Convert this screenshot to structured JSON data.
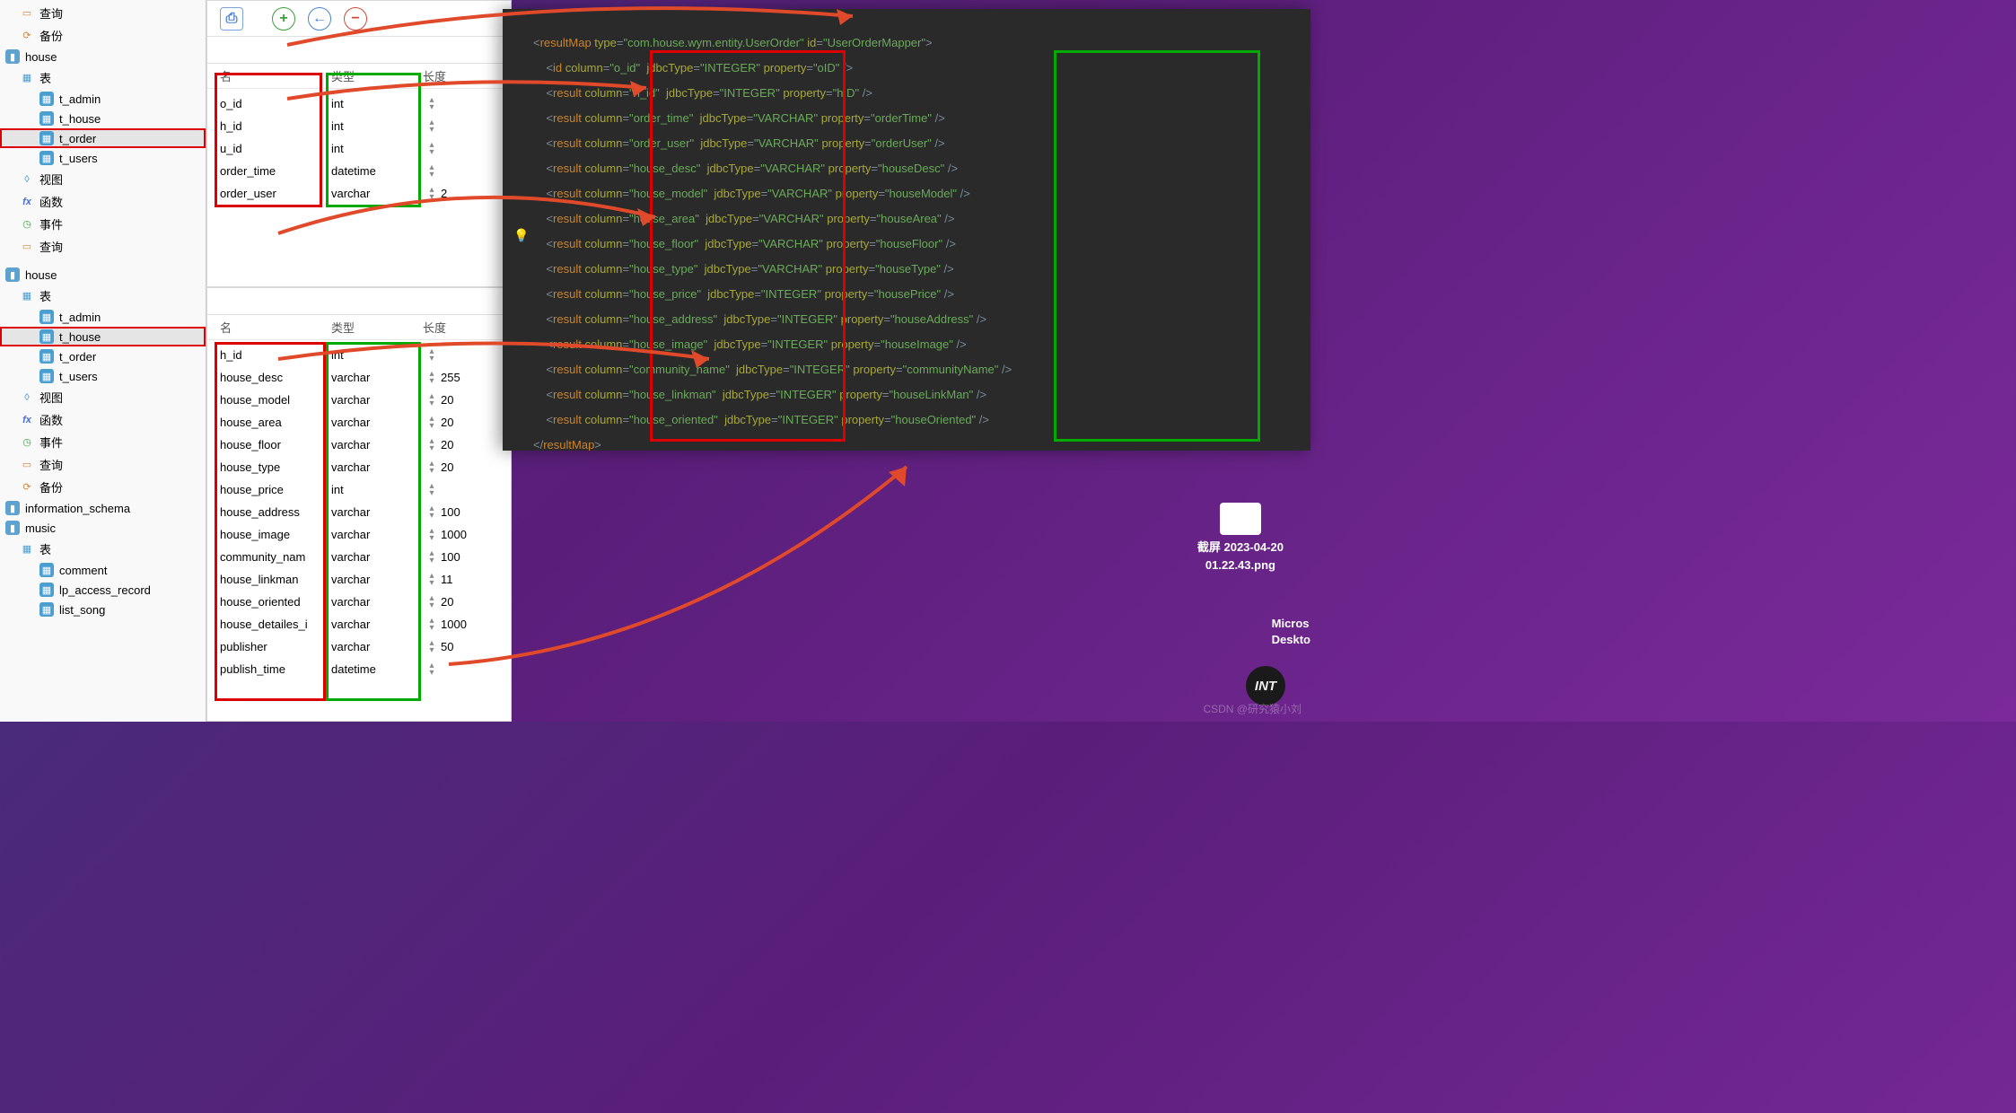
{
  "tree1": {
    "query": "查询",
    "backup": "备份",
    "db": "house",
    "tables": "表",
    "items": [
      "t_admin",
      "t_house",
      "t_order",
      "t_users"
    ],
    "selected": "t_order",
    "views": "视图",
    "fx": "函数",
    "events": "事件",
    "query2": "查询"
  },
  "tree2": {
    "db": "house",
    "tables": "表",
    "items": [
      "t_admin",
      "t_house",
      "t_order",
      "t_users"
    ],
    "selected": "t_house",
    "views": "视图",
    "fx": "函数",
    "events": "事件",
    "query": "查询",
    "backup": "备份",
    "infoschema": "information_schema",
    "music": "music",
    "music_tables": "表",
    "music_items": [
      "comment",
      "lp_access_record",
      "list_song"
    ]
  },
  "cols_header": {
    "name": "名",
    "type": "类型",
    "len": "长度"
  },
  "table1": {
    "rows": [
      {
        "n": "o_id",
        "t": "int",
        "l": ""
      },
      {
        "n": "h_id",
        "t": "int",
        "l": ""
      },
      {
        "n": "u_id",
        "t": "int",
        "l": ""
      },
      {
        "n": "order_time",
        "t": "datetime",
        "l": ""
      },
      {
        "n": "order_user",
        "t": "varchar",
        "l": "2"
      }
    ]
  },
  "table2": {
    "rows": [
      {
        "n": "h_id",
        "t": "int",
        "l": ""
      },
      {
        "n": "house_desc",
        "t": "varchar",
        "l": "255"
      },
      {
        "n": "house_model",
        "t": "varchar",
        "l": "20"
      },
      {
        "n": "house_area",
        "t": "varchar",
        "l": "20"
      },
      {
        "n": "house_floor",
        "t": "varchar",
        "l": "20"
      },
      {
        "n": "house_type",
        "t": "varchar",
        "l": "20"
      },
      {
        "n": "house_price",
        "t": "int",
        "l": ""
      },
      {
        "n": "house_address",
        "t": "varchar",
        "l": "100"
      },
      {
        "n": "house_image",
        "t": "varchar",
        "l": "1000"
      },
      {
        "n": "community_nam",
        "t": "varchar",
        "l": "100"
      },
      {
        "n": "house_linkman",
        "t": "varchar",
        "l": "11"
      },
      {
        "n": "house_oriented",
        "t": "varchar",
        "l": "20"
      },
      {
        "n": "house_detailes_i",
        "t": "varchar",
        "l": "1000"
      },
      {
        "n": "publisher",
        "t": "varchar",
        "l": "50"
      },
      {
        "n": "publish_time",
        "t": "datetime",
        "l": ""
      }
    ]
  },
  "code": {
    "type": "com.house.wym.entity.UserOrder",
    "id": "UserOrderMapper",
    "rows": [
      {
        "tag": "id",
        "col": "o_id",
        "jt": "INTEGER",
        "prop": "oID"
      },
      {
        "tag": "result",
        "col": "h_id",
        "jt": "INTEGER",
        "prop": "hID"
      },
      {
        "tag": "result",
        "col": "order_time",
        "jt": "VARCHAR",
        "prop": "orderTime"
      },
      {
        "tag": "result",
        "col": "order_user",
        "jt": "VARCHAR",
        "prop": "orderUser"
      },
      {
        "tag": "result",
        "col": "house_desc",
        "jt": "VARCHAR",
        "prop": "houseDesc"
      },
      {
        "tag": "result",
        "col": "house_model",
        "jt": "VARCHAR",
        "prop": "houseModel"
      },
      {
        "tag": "result",
        "col": "house_area",
        "jt": "VARCHAR",
        "prop": "houseArea"
      },
      {
        "tag": "result",
        "col": "house_floor",
        "jt": "VARCHAR",
        "prop": "houseFloor"
      },
      {
        "tag": "result",
        "col": "house_type",
        "jt": "VARCHAR",
        "prop": "houseType"
      },
      {
        "tag": "result",
        "col": "house_price",
        "jt": "INTEGER",
        "prop": "housePrice"
      },
      {
        "tag": "result",
        "col": "house_address",
        "jt": "INTEGER",
        "prop": "houseAddress"
      },
      {
        "tag": "result",
        "col": "house_image",
        "jt": "INTEGER",
        "prop": "houseImage"
      },
      {
        "tag": "result",
        "col": "community_name",
        "jt": "INTEGER",
        "prop": "communityName"
      },
      {
        "tag": "result",
        "col": "house_linkman",
        "jt": "INTEGER",
        "prop": "houseLinkMan"
      },
      {
        "tag": "result",
        "col": "house_oriented",
        "jt": "INTEGER",
        "prop": "houseOriented"
      }
    ],
    "close": "</resultMap>"
  },
  "desktop": {
    "filename": "截屏 2023-04-20\n01.22.43.png",
    "edge": "Micros\nDeskto"
  },
  "watermark": "CSDN @研究猿小刘",
  "logo": "INT"
}
